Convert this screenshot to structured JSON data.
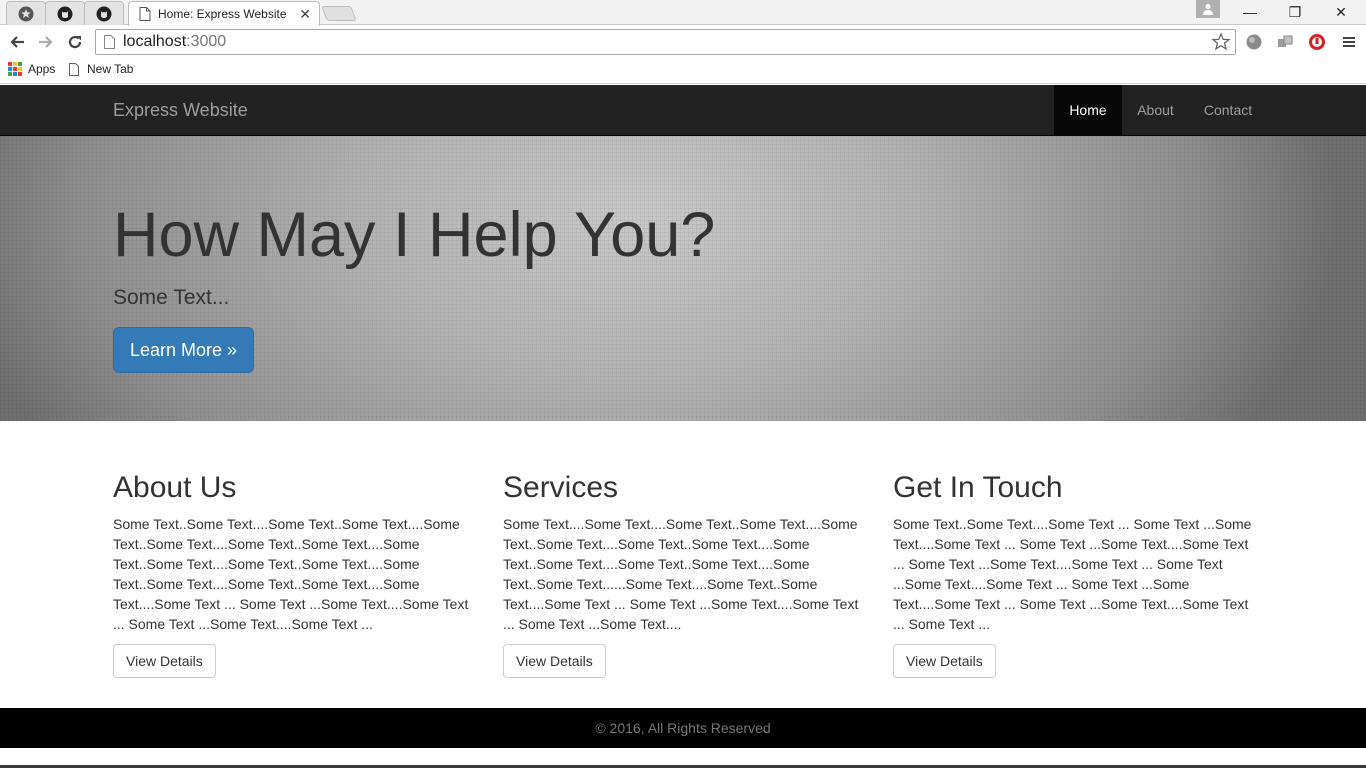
{
  "browser": {
    "active_tab_title": "Home: Express Website",
    "tab_close_glyph": "✕",
    "url_host": "localhost",
    "url_port": ":3000",
    "window_controls": {
      "minimize": "—",
      "restore": "❐",
      "close": "✕"
    },
    "bookmarks": [
      {
        "label": "Apps",
        "icon": "apps-grid-icon"
      },
      {
        "label": "New Tab",
        "icon": "page-icon"
      }
    ]
  },
  "site": {
    "brand": "Express Website",
    "nav": [
      {
        "label": "Home",
        "active": true
      },
      {
        "label": "About",
        "active": false
      },
      {
        "label": "Contact",
        "active": false
      }
    ],
    "jumbotron": {
      "title": "How May I Help You?",
      "subtitle": "Some Text...",
      "button": "Learn More »"
    },
    "columns": [
      {
        "heading": "About Us",
        "text": "Some Text..Some Text....Some Text..Some Text....Some Text..Some Text....Some Text..Some Text....Some Text..Some Text....Some Text..Some Text....Some Text..Some Text....Some Text..Some Text....Some Text....Some Text ... Some Text ...Some Text....Some Text ... Some Text ...Some Text....Some Text ...",
        "button": "View Details"
      },
      {
        "heading": "Services",
        "text": "Some Text....Some Text....Some Text..Some Text....Some Text..Some Text....Some Text..Some Text....Some Text..Some Text....Some Text..Some Text....Some Text..Some Text......Some Text....Some Text..Some Text....Some Text ... Some Text ...Some Text....Some Text ... Some Text ...Some Text....",
        "button": "View Details"
      },
      {
        "heading": "Get In Touch",
        "text": "Some Text..Some Text....Some Text ... Some Text ...Some Text....Some Text ... Some Text ...Some Text....Some Text ... Some Text ...Some Text....Some Text ... Some Text ...Some Text....Some Text ... Some Text ...Some Text....Some Text ... Some Text ...Some Text....Some Text ... Some Text ...",
        "button": "View Details"
      }
    ],
    "footer": "© 2016, All Rights Reserved"
  },
  "colors": {
    "navbar_bg": "#222222",
    "nav_active_bg": "#080808",
    "primary_button": "#337ab7",
    "footer_bg": "#000000",
    "text": "#333333"
  }
}
